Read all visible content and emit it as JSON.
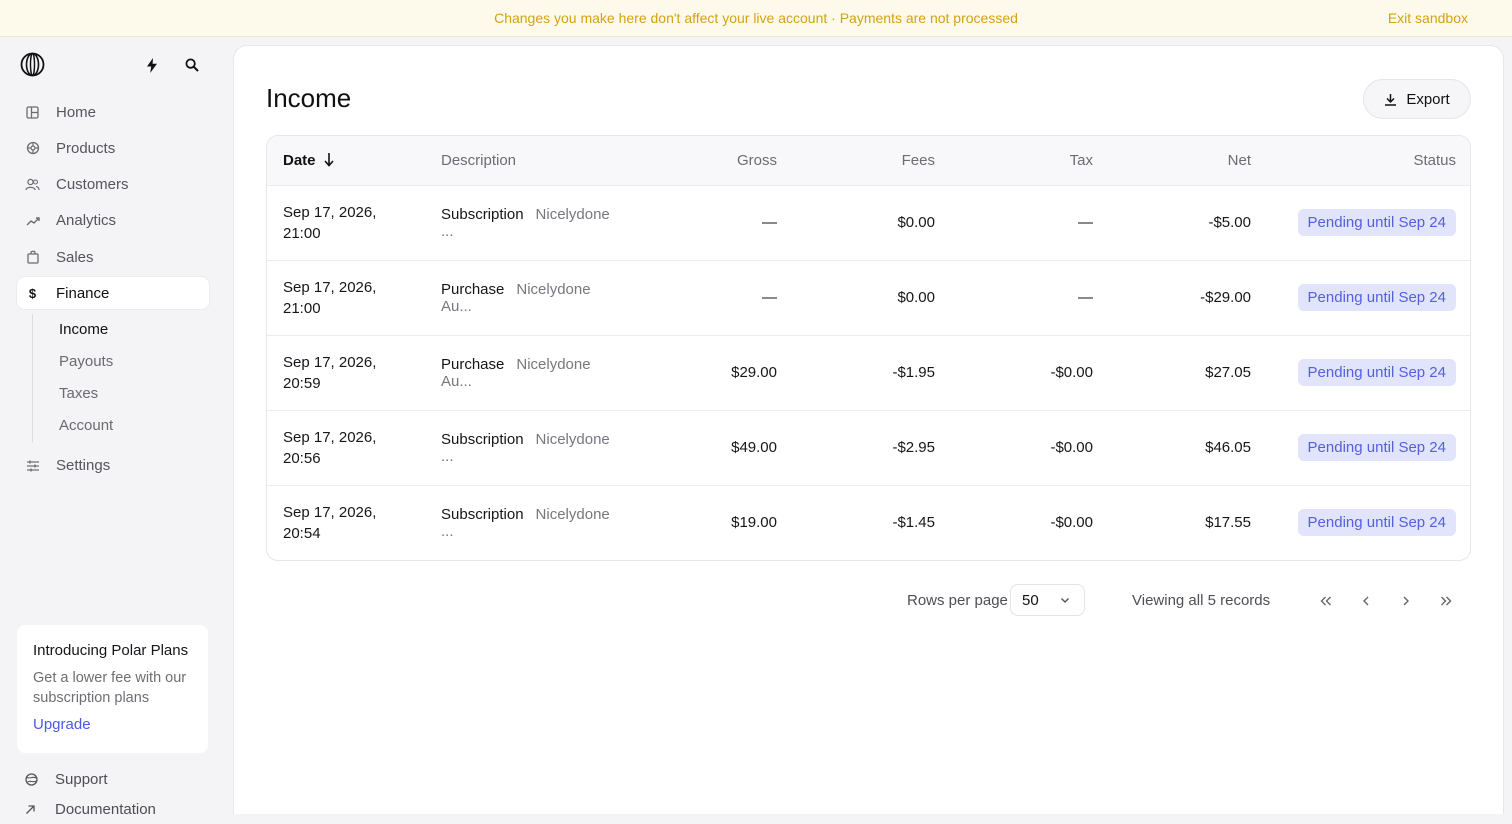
{
  "banner": {
    "message": "Changes you make here don't affect your live account · Payments are not processed",
    "exit_label": "Exit sandbox"
  },
  "icons": {
    "logo": "polar-logo-icon",
    "flash": "lightning-icon",
    "search": "search-icon"
  },
  "sidebar": {
    "items": [
      {
        "label": "Home",
        "icon": "home-icon",
        "active": false
      },
      {
        "label": "Products",
        "icon": "products-icon",
        "active": false
      },
      {
        "label": "Customers",
        "icon": "customers-icon",
        "active": false
      },
      {
        "label": "Analytics",
        "icon": "analytics-icon",
        "active": false
      },
      {
        "label": "Sales",
        "icon": "sales-bag-icon",
        "active": false
      },
      {
        "label": "Finance",
        "icon": "dollar-icon",
        "active": true
      }
    ],
    "finance_sub": [
      {
        "label": "Income",
        "active": true
      },
      {
        "label": "Payouts",
        "active": false
      },
      {
        "label": "Taxes",
        "active": false
      },
      {
        "label": "Account",
        "active": false
      }
    ],
    "settings_label": "Settings"
  },
  "promo": {
    "title": "Introducing Polar Plans",
    "text": "Get a lower fee with our subscription plans",
    "link": "Upgrade"
  },
  "footer": {
    "support": "Support",
    "documentation": "Documentation"
  },
  "page": {
    "title": "Income",
    "export_label": "Export"
  },
  "table": {
    "columns": [
      "Date",
      "Description",
      "Gross",
      "Fees",
      "Tax",
      "Net",
      "Status"
    ],
    "rows": [
      {
        "date_line1": "Sep 17, 2026,",
        "date_line2": "21:00",
        "type": "Subscription",
        "name": "Nicelydone ...",
        "gross": "—",
        "fees": "$0.00",
        "tax": "—",
        "net": "-$5.00",
        "status": "Pending until Sep 24"
      },
      {
        "date_line1": "Sep 17, 2026,",
        "date_line2": "21:00",
        "type": "Purchase",
        "name": "Nicelydone Au...",
        "gross": "—",
        "fees": "$0.00",
        "tax": "—",
        "net": "-$29.00",
        "status": "Pending until Sep 24"
      },
      {
        "date_line1": "Sep 17, 2026,",
        "date_line2": "20:59",
        "type": "Purchase",
        "name": "Nicelydone Au...",
        "gross": "$29.00",
        "fees": "-$1.95",
        "tax": "-$0.00",
        "net": "$27.05",
        "status": "Pending until Sep 24"
      },
      {
        "date_line1": "Sep 17, 2026,",
        "date_line2": "20:56",
        "type": "Subscription",
        "name": "Nicelydone ...",
        "gross": "$49.00",
        "fees": "-$2.95",
        "tax": "-$0.00",
        "net": "$46.05",
        "status": "Pending until Sep 24"
      },
      {
        "date_line1": "Sep 17, 2026,",
        "date_line2": "20:54",
        "type": "Subscription",
        "name": "Nicelydone ...",
        "gross": "$19.00",
        "fees": "-$1.45",
        "tax": "-$0.00",
        "net": "$17.55",
        "status": "Pending until Sep 24"
      }
    ]
  },
  "pagination": {
    "rows_per_page_label": "Rows per page",
    "rows_per_page_value": "50",
    "viewing_text": "Viewing all 5 records"
  },
  "colors": {
    "banner_text": "#d3a311",
    "accent": "#4b5ae4",
    "status_bg": "#e1e4fb",
    "status_text": "#5560df"
  }
}
